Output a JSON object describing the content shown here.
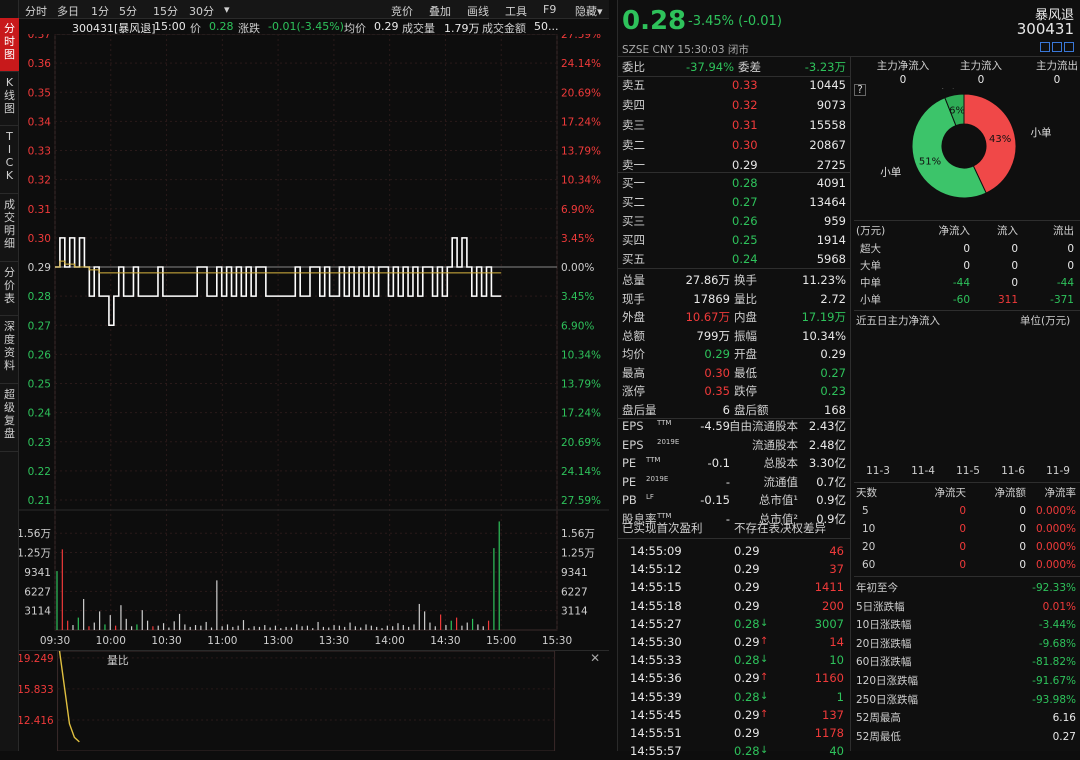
{
  "vtabs": [
    "分时图",
    "K线图",
    "TICK",
    "成交明细",
    "分价表",
    "深度资料",
    "超级复盘"
  ],
  "toolbar": {
    "left": [
      "分时",
      "多日",
      "1分",
      "5分",
      "15分",
      "30分",
      "▾"
    ],
    "right": [
      "竞价",
      "叠加",
      "画线",
      "工具",
      "F9",
      "隐藏▾"
    ]
  },
  "info": {
    "code_name": "300431[暴风退]",
    "time": "15:00",
    "price_label": "价",
    "price": "0.28",
    "chg_label": "涨跌",
    "chg": "-0.01(-3.45%)",
    "avg_label": "均价",
    "avg": "0.29",
    "vol_label": "成交量",
    "vol": "1.79万",
    "amt_label": "成交金额",
    "amt": "50..."
  },
  "chart_data": [
    {
      "type": "line",
      "title": "",
      "left_ticks": [
        "0.37",
        "0.36",
        "0.35",
        "0.34",
        "0.33",
        "0.32",
        "0.31",
        "0.30",
        "0.29",
        "0.28",
        "0.27",
        "0.26",
        "0.25",
        "0.24",
        "0.23",
        "0.22",
        "0.21"
      ],
      "right_ticks": [
        "27.59%",
        "24.14%",
        "20.69%",
        "17.24%",
        "13.79%",
        "10.34%",
        "6.90%",
        "3.45%",
        "0.00%",
        "3.45%",
        "6.90%",
        "10.34%",
        "13.79%",
        "17.24%",
        "20.69%",
        "24.14%",
        "27.59%"
      ],
      "ylim": [
        0.21,
        0.37
      ],
      "prev_close": 0.29,
      "x_ticks": [
        "09:30",
        "10:00",
        "10:30",
        "11:00",
        "13:00",
        "13:30",
        "14:00",
        "14:30",
        "15:00",
        "15:30"
      ],
      "series": [
        {
          "key": "price",
          "color": "#ffffff",
          "values": [
            0.29,
            0.3,
            0.29,
            0.3,
            0.29,
            0.3,
            0.29,
            0.28,
            0.29,
            0.28,
            0.28,
            0.27,
            0.28,
            0.29,
            0.28,
            0.28,
            0.29,
            0.28,
            0.28,
            0.28,
            0.28,
            0.29,
            0.28,
            0.28,
            0.28,
            0.28,
            0.28,
            0.28,
            0.28,
            0.29,
            0.29,
            0.28,
            0.28,
            0.29,
            0.28,
            0.29,
            0.28,
            0.29,
            0.28,
            0.29,
            0.28,
            0.29,
            0.29,
            0.28,
            0.28,
            0.28,
            0.28,
            0.28,
            0.28,
            0.29,
            0.28,
            0.28,
            0.29,
            0.29,
            0.28,
            0.29,
            0.28,
            0.28,
            0.29,
            0.28,
            0.29,
            0.28,
            0.29,
            0.28,
            0.29,
            0.28,
            0.29,
            0.29,
            0.28,
            0.29,
            0.28,
            0.29,
            0.28,
            0.29,
            0.28,
            0.29,
            0.29,
            0.28,
            0.29,
            0.28,
            0.29,
            0.3,
            0.29,
            0.3,
            0.29,
            0.28,
            0.29,
            0.28,
            0.29,
            0.28,
            0.28,
            0.28
          ]
        },
        {
          "key": "avg",
          "color": "#d9b640",
          "values": [
            0.29,
            0.292,
            0.291,
            0.291,
            0.29,
            0.29,
            0.29,
            0.289,
            0.289,
            0.288,
            0.288,
            0.288,
            0.288,
            0.288,
            0.288,
            0.288,
            0.288,
            0.288,
            0.288,
            0.288,
            0.288,
            0.288,
            0.288,
            0.288,
            0.288,
            0.288,
            0.288,
            0.288,
            0.288,
            0.288,
            0.288,
            0.288,
            0.288,
            0.288,
            0.288,
            0.288,
            0.288,
            0.288,
            0.288,
            0.288,
            0.288,
            0.288,
            0.288,
            0.288,
            0.288,
            0.288,
            0.288,
            0.288,
            0.288,
            0.288,
            0.288,
            0.288,
            0.288,
            0.288,
            0.288,
            0.288,
            0.288,
            0.288,
            0.288,
            0.288,
            0.288,
            0.288,
            0.288,
            0.288,
            0.288,
            0.288,
            0.288,
            0.288,
            0.288,
            0.288,
            0.288,
            0.288,
            0.288,
            0.288,
            0.288,
            0.288,
            0.288,
            0.288,
            0.288,
            0.288,
            0.288,
            0.288,
            0.288,
            0.288,
            0.288,
            0.288,
            0.288,
            0.288,
            0.288,
            0.288,
            0.288,
            0.288
          ]
        }
      ]
    },
    {
      "type": "bar",
      "title": "",
      "ticks": [
        "1.56万",
        "1.25万",
        "9341",
        "6227",
        "3114"
      ],
      "ylim": [
        0,
        18700
      ],
      "values": [
        9500,
        13000,
        1500,
        800,
        2000,
        5000,
        600,
        1200,
        3000,
        900,
        2400,
        700,
        4000,
        1800,
        600,
        900,
        3200,
        1500,
        600,
        700,
        1100,
        400,
        1400,
        2600,
        900,
        500,
        800,
        700,
        1300,
        400,
        8000,
        600,
        900,
        500,
        700,
        1600,
        300,
        600,
        500,
        800,
        400,
        700,
        300,
        500,
        400,
        900,
        600,
        700,
        300,
        1300,
        500,
        400,
        800,
        700,
        500,
        1200,
        600,
        400,
        900,
        700,
        500,
        300,
        700,
        600,
        1100,
        800,
        500,
        900,
        4200,
        3000,
        1200,
        600,
        2500,
        800,
        1500,
        2000,
        700,
        1200,
        1800,
        900,
        600,
        1500,
        13200,
        17500
      ],
      "colors": [
        "#2ec25b",
        "#f03a3a",
        "#f03a3a",
        "#cfcfcf",
        "#2ec25b",
        "#cfcfcf",
        "#f03a3a",
        "#cfcfcf",
        "#cfcfcf",
        "#2ec25b",
        "#cfcfcf",
        "#f03a3a",
        "#cfcfcf",
        "#cfcfcf",
        "#cfcfcf",
        "#2ec25b",
        "#cfcfcf",
        "#cfcfcf",
        "#f03a3a",
        "#cfcfcf",
        "#cfcfcf",
        "#cfcfcf",
        "#cfcfcf",
        "#cfcfcf",
        "#cfcfcf",
        "#cfcfcf",
        "#cfcfcf",
        "#cfcfcf",
        "#cfcfcf",
        "#cfcfcf",
        "#cfcfcf",
        "#cfcfcf",
        "#cfcfcf",
        "#cfcfcf",
        "#cfcfcf",
        "#cfcfcf",
        "#cfcfcf",
        "#cfcfcf",
        "#cfcfcf",
        "#cfcfcf",
        "#cfcfcf",
        "#cfcfcf",
        "#cfcfcf",
        "#cfcfcf",
        "#cfcfcf",
        "#cfcfcf",
        "#cfcfcf",
        "#cfcfcf",
        "#cfcfcf",
        "#cfcfcf",
        "#cfcfcf",
        "#cfcfcf",
        "#cfcfcf",
        "#cfcfcf",
        "#cfcfcf",
        "#cfcfcf",
        "#cfcfcf",
        "#cfcfcf",
        "#cfcfcf",
        "#cfcfcf",
        "#cfcfcf",
        "#cfcfcf",
        "#cfcfcf",
        "#cfcfcf",
        "#cfcfcf",
        "#cfcfcf",
        "#cfcfcf",
        "#cfcfcf",
        "#cfcfcf",
        "#cfcfcf",
        "#cfcfcf",
        "#cfcfcf",
        "#f03a3a",
        "#cfcfcf",
        "#2ec25b",
        "#f03a3a",
        "#cfcfcf",
        "#cfcfcf",
        "#2ec25b",
        "#cfcfcf",
        "#cfcfcf",
        "#f03a3a",
        "#2ec25b",
        "#2ec25b"
      ]
    },
    {
      "type": "line",
      "title": "量比",
      "ticks": [
        "19.249",
        "15.833",
        "12.416"
      ],
      "ylim": [
        9,
        20
      ],
      "values": [
        20,
        16,
        12,
        10.5,
        10
      ]
    }
  ],
  "header": {
    "price": "0.28",
    "chg": "-3.45% (-0.01)",
    "name": "暴风退",
    "code": "300431",
    "sub": "SZSE CNY 15:30:03 闭市"
  },
  "webi": {
    "l1": "委比",
    "v1": "-37.94%",
    "l2": "委差",
    "v2": "-3.23万"
  },
  "sell": [
    {
      "l": "卖五",
      "p": "0.33",
      "v": "10445"
    },
    {
      "l": "卖四",
      "p": "0.32",
      "v": "9073"
    },
    {
      "l": "卖三",
      "p": "0.31",
      "v": "15558"
    },
    {
      "l": "卖二",
      "p": "0.30",
      "v": "20867"
    },
    {
      "l": "卖一",
      "p": "0.29",
      "v": "2725"
    }
  ],
  "buy": [
    {
      "l": "买一",
      "p": "0.28",
      "v": "4091"
    },
    {
      "l": "买二",
      "p": "0.27",
      "v": "13464"
    },
    {
      "l": "买三",
      "p": "0.26",
      "v": "959"
    },
    {
      "l": "买四",
      "p": "0.25",
      "v": "1914"
    },
    {
      "l": "买五",
      "p": "0.24",
      "v": "5968"
    }
  ],
  "stats": [
    {
      "l1": "总量",
      "v1": "27.86万",
      "c1": "white",
      "l2": "换手",
      "v2": "11.23%",
      "c2": "white"
    },
    {
      "l1": "现手",
      "v1": "17869",
      "c1": "white",
      "l2": "量比",
      "v2": "2.72",
      "c2": "white"
    },
    {
      "l1": "外盘",
      "v1": "10.67万",
      "c1": "red",
      "l2": "内盘",
      "v2": "17.19万",
      "c2": "green"
    },
    {
      "l1": "总额",
      "v1": "799万",
      "c1": "white",
      "l2": "振幅",
      "v2": "10.34%",
      "c2": "white"
    },
    {
      "l1": "均价",
      "v1": "0.29",
      "c1": "green",
      "l2": "开盘",
      "v2": "0.29",
      "c2": "white"
    },
    {
      "l1": "最高",
      "v1": "0.30",
      "c1": "red",
      "l2": "最低",
      "v2": "0.27",
      "c2": "green"
    },
    {
      "l1": "涨停",
      "v1": "0.35",
      "c1": "red",
      "l2": "跌停",
      "v2": "0.23",
      "c2": "green"
    },
    {
      "l1": "盘后量",
      "v1": "6",
      "c1": "white",
      "l2": "盘后额",
      "v2": "168",
      "c2": "white"
    }
  ],
  "fin": [
    {
      "l1": "EPS",
      "s1": "TTM",
      "v1": "-4.59",
      "l2": "自由流通股本",
      "v2": "2.43亿"
    },
    {
      "l1": "EPS",
      "s1": "2019E",
      "v1": "",
      "l2": "流通股本",
      "v2": "2.48亿"
    },
    {
      "l1": "PE",
      "s1": "TTM",
      "v1": "-0.1",
      "l2": "总股本",
      "v2": "3.30亿"
    },
    {
      "l1": "PE",
      "s1": "2019E",
      "v1": "-",
      "l2": "流通值",
      "v2": "0.7亿"
    },
    {
      "l1": "PB",
      "s1": "LF",
      "v1": "-0.15",
      "l2": "总市值¹",
      "v2": "0.9亿"
    },
    {
      "l1": "股息率",
      "s1": "TTM",
      "v1": "-",
      "l2": "总市值²",
      "v2": "0.9亿"
    }
  ],
  "fin_note": {
    "l": "已实现首次盈利",
    "r": "不存在表决权差异"
  },
  "ticks": [
    {
      "t": "14:55:09",
      "p": "0.29",
      "pc": "white",
      "a": "",
      "v": "46",
      "vc": "red"
    },
    {
      "t": "14:55:12",
      "p": "0.29",
      "pc": "white",
      "a": "",
      "v": "37",
      "vc": "red"
    },
    {
      "t": "14:55:15",
      "p": "0.29",
      "pc": "white",
      "a": "",
      "v": "1411",
      "vc": "red"
    },
    {
      "t": "14:55:18",
      "p": "0.29",
      "pc": "white",
      "a": "",
      "v": "200",
      "vc": "red"
    },
    {
      "t": "14:55:27",
      "p": "0.28",
      "pc": "green",
      "a": "↓",
      "v": "3007",
      "vc": "green"
    },
    {
      "t": "14:55:30",
      "p": "0.29",
      "pc": "white",
      "a": "↑",
      "v": "14",
      "vc": "red"
    },
    {
      "t": "14:55:33",
      "p": "0.28",
      "pc": "green",
      "a": "↓",
      "v": "10",
      "vc": "green"
    },
    {
      "t": "14:55:36",
      "p": "0.29",
      "pc": "white",
      "a": "↑",
      "v": "1160",
      "vc": "red"
    },
    {
      "t": "14:55:39",
      "p": "0.28",
      "pc": "green",
      "a": "↓",
      "v": "1",
      "vc": "green"
    },
    {
      "t": "14:55:45",
      "p": "0.29",
      "pc": "white",
      "a": "↑",
      "v": "137",
      "vc": "red"
    },
    {
      "t": "14:55:51",
      "p": "0.29",
      "pc": "white",
      "a": "",
      "v": "1178",
      "vc": "red"
    },
    {
      "t": "14:55:57",
      "p": "0.28",
      "pc": "green",
      "a": "↓",
      "v": "40",
      "vc": "green"
    }
  ],
  "flow": {
    "heads": [
      "主力净流入",
      "主力流入",
      "主力流出"
    ],
    "vals": [
      "0",
      "0",
      "0"
    ],
    "q": "?"
  },
  "pie": {
    "slices": [
      {
        "name": "小单",
        "pct": 43,
        "label": "43%",
        "color": "#f04848"
      },
      {
        "name": "小单",
        "pct": 51,
        "label": "51%",
        "color": "#3cc46a"
      },
      {
        "name": "中单",
        "pct": 6,
        "label": "6%",
        "color": "#2fae57"
      }
    ]
  },
  "flowtable": {
    "head": [
      "(万元)",
      "净流入",
      "流入",
      "流出"
    ],
    "rows": [
      {
        "n": "超大",
        "a": "0",
        "ac": "white",
        "b": "0",
        "bc": "white",
        "c": "0",
        "cc": "white"
      },
      {
        "n": "大单",
        "a": "0",
        "ac": "white",
        "b": "0",
        "bc": "white",
        "c": "0",
        "cc": "white"
      },
      {
        "n": "中单",
        "a": "-44",
        "ac": "green",
        "b": "0",
        "bc": "white",
        "c": "-44",
        "cc": "green"
      },
      {
        "n": "小单",
        "a": "-60",
        "ac": "green",
        "b": "311",
        "bc": "red",
        "c": "-371",
        "cc": "green"
      }
    ]
  },
  "five": {
    "title": "近五日主力净流入",
    "unit": "单位(万元)",
    "dates": [
      "11-3",
      "11-4",
      "11-5",
      "11-6",
      "11-9"
    ]
  },
  "days": {
    "head": [
      "天数",
      "净流天",
      "净流额",
      "净流率"
    ],
    "rows": [
      {
        "d": "5",
        "a": "0",
        "b": "0",
        "c": "0.000%"
      },
      {
        "d": "10",
        "a": "0",
        "b": "0",
        "c": "0.000%"
      },
      {
        "d": "20",
        "a": "0",
        "b": "0",
        "c": "0.000%"
      },
      {
        "d": "60",
        "a": "0",
        "b": "0",
        "c": "0.000%"
      }
    ]
  },
  "perf": [
    {
      "l": "年初至今",
      "v": "-92.33%",
      "c": "green"
    },
    {
      "l": "5日涨跌幅",
      "v": "0.01%",
      "c": "red"
    },
    {
      "l": "10日涨跌幅",
      "v": "-3.44%",
      "c": "green"
    },
    {
      "l": "20日涨跌幅",
      "v": "-9.68%",
      "c": "green"
    },
    {
      "l": "60日涨跌幅",
      "v": "-81.82%",
      "c": "green"
    },
    {
      "l": "120日涨跌幅",
      "v": "-91.67%",
      "c": "green"
    },
    {
      "l": "250日涨跌幅",
      "v": "-93.98%",
      "c": "green"
    },
    {
      "l": "52周最高",
      "v": "6.16",
      "c": "white"
    },
    {
      "l": "52周最低",
      "v": "0.27",
      "c": "white"
    }
  ]
}
